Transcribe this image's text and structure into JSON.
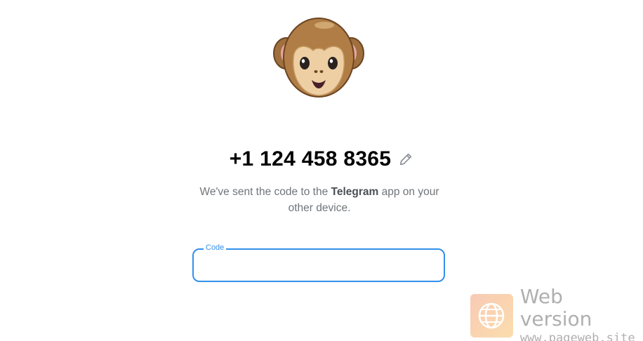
{
  "auth": {
    "phone_number": "+1 124 458 8365",
    "description_prefix": "We've sent the code to the ",
    "description_app": "Telegram",
    "description_suffix": " app on your other device.",
    "code_label": "Code",
    "code_value": ""
  },
  "icons": {
    "avatar": "monkey-face-icon",
    "edit": "pencil-icon"
  },
  "watermark": {
    "title": "Web version",
    "url": "www.pageweb.site",
    "icon": "globe-icon"
  },
  "colors": {
    "accent": "#3390ec",
    "secondary_text": "#707579"
  }
}
